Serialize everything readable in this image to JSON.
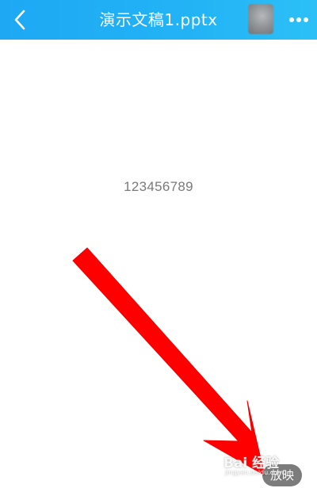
{
  "header": {
    "title": "演示文稿1.pptx",
    "back_icon": "chevron-left-icon",
    "more_icon": "more-horizontal-icon"
  },
  "slide": {
    "text": "123456789"
  },
  "footer": {
    "play_label": "放映"
  },
  "annotation": {
    "arrow_icon": "red-arrow-icon",
    "color": "#ff0000"
  },
  "watermark": {
    "brand": "Bai 经验",
    "url": "jingyan.baidu.com"
  },
  "colors": {
    "header_bg": "#22b3f5",
    "play_bg": "#5f5f5f"
  }
}
